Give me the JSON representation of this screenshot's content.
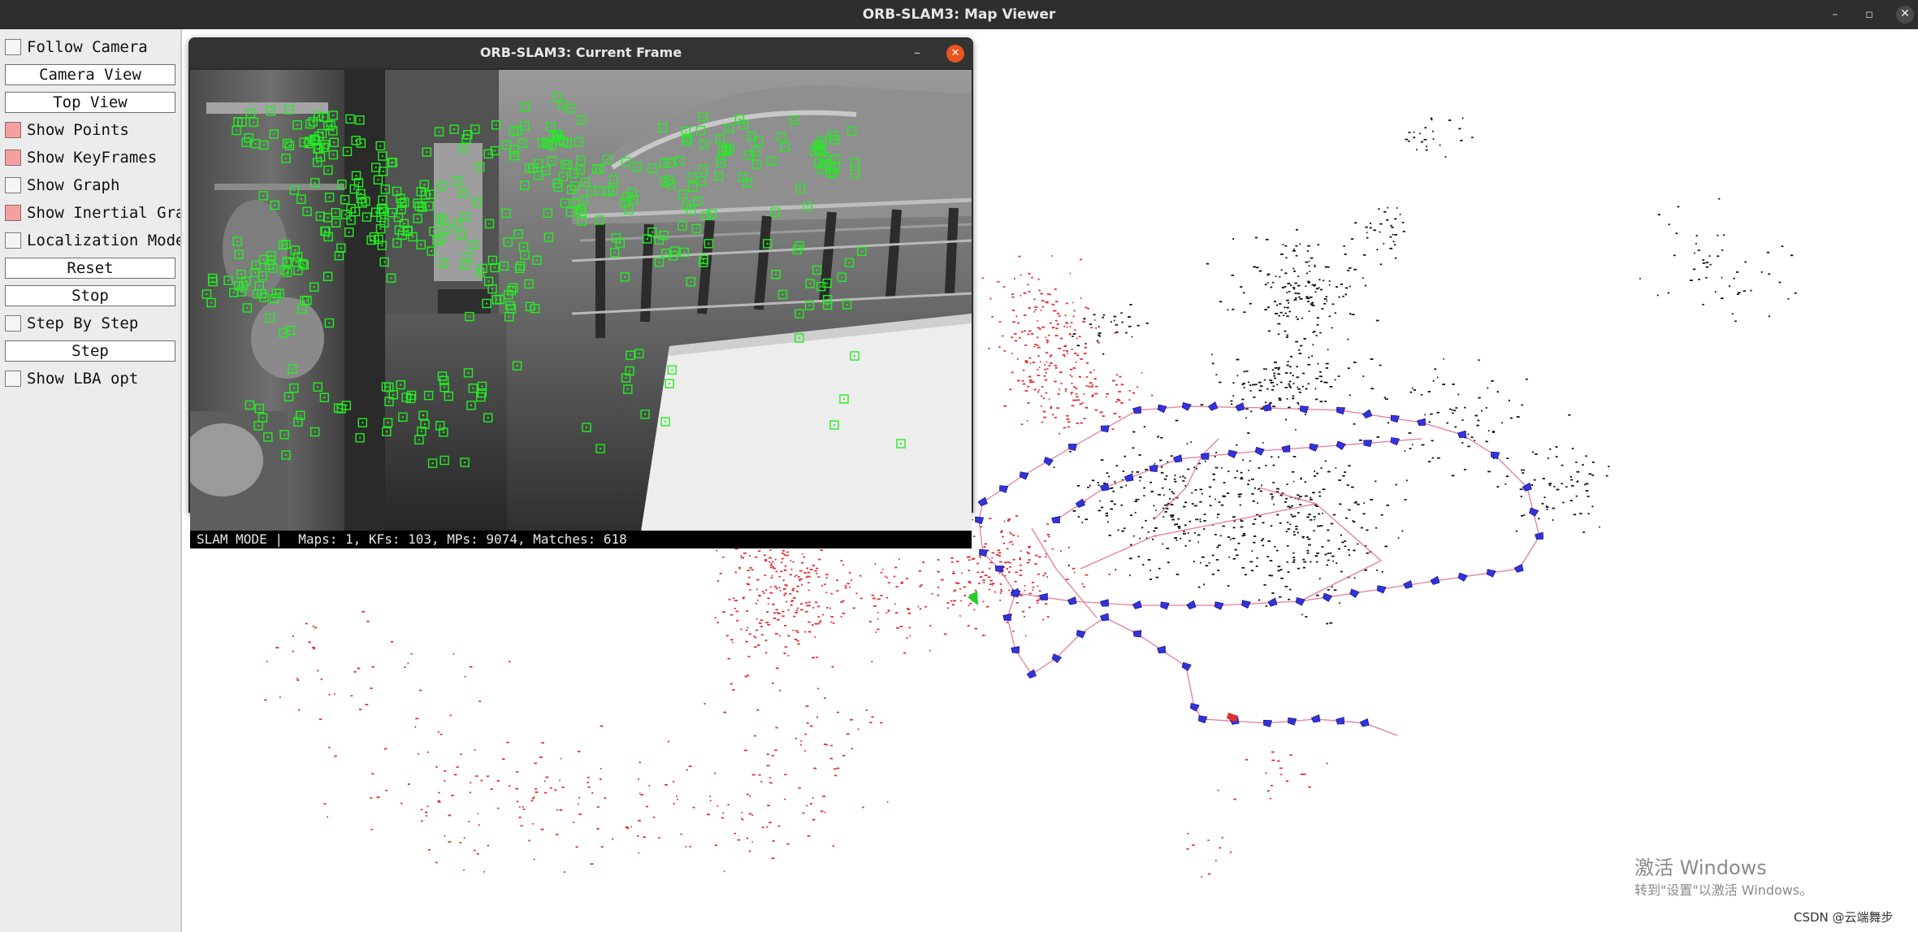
{
  "window": {
    "title": "ORB-SLAM3: Map Viewer",
    "controls": {
      "minimize": "–",
      "maximize": "▫",
      "close": "✕"
    }
  },
  "panel": {
    "items": [
      {
        "kind": "checkbox",
        "label": "Follow Camera",
        "checked": false
      },
      {
        "kind": "button",
        "label": "Camera View"
      },
      {
        "kind": "button",
        "label": "Top View"
      },
      {
        "kind": "checkbox",
        "label": "Show Points",
        "checked": true
      },
      {
        "kind": "checkbox",
        "label": "Show KeyFrames",
        "checked": true
      },
      {
        "kind": "checkbox",
        "label": "Show Graph",
        "checked": false
      },
      {
        "kind": "checkbox",
        "label": "Show Inertial Graph",
        "checked": true
      },
      {
        "kind": "checkbox",
        "label": "Localization Mode",
        "checked": false
      },
      {
        "kind": "button",
        "label": "Reset"
      },
      {
        "kind": "button",
        "label": "Stop"
      },
      {
        "kind": "checkbox",
        "label": "Step By Step",
        "checked": false
      },
      {
        "kind": "button",
        "label": "Step"
      },
      {
        "kind": "checkbox",
        "label": "Show LBA opt",
        "checked": false
      }
    ]
  },
  "frame_window": {
    "title": "ORB-SLAM3: Current Frame",
    "minimize": "–",
    "close": "✕",
    "status": "SLAM MODE |  Maps: 1, KFs: 103, MPs: 9074, Matches: 618"
  },
  "colors": {
    "map_point": "#111111",
    "reference_point": "#e03030",
    "keyframe": "#3333dd",
    "graph_edge": "#e87a9a",
    "current_camera": "#22cc22",
    "feature_box": "#22ee22",
    "checkbox_on": "#f5a0a0"
  },
  "watermark": {
    "title": "激活 Windows",
    "subtitle": "转到\"设置\"以激活 Windows。",
    "csdn": "CSDN @云端舞步"
  }
}
